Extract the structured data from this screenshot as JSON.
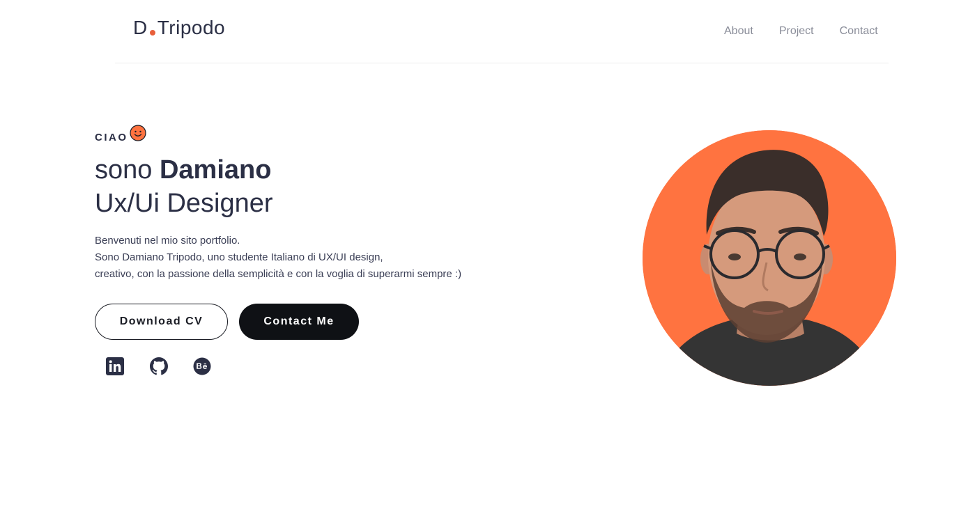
{
  "nav": {
    "logo_left": "D",
    "logo_right": "Tripodo",
    "links": [
      "About",
      "Project",
      "Contact"
    ]
  },
  "hero": {
    "greeting": "CIAO",
    "headline_prefix": "sono ",
    "headline_name": "Damiano",
    "subtitle": "Ux/Ui Designer",
    "intro": [
      "Benvenuti nel mio sito portfolio.",
      "Sono Damiano Tripodo, uno studente Italiano di UX/UI design,",
      "creativo, con la passione della semplicità e con la voglia di superarmi sempre :)"
    ],
    "download_label": "Download CV",
    "contact_label": "Contact Me"
  },
  "socials": [
    "linkedin-icon",
    "github-icon",
    "behance-icon"
  ],
  "colors": {
    "accent": "#ff7340",
    "text": "#2b2f45",
    "button_dark": "#0f1115",
    "nav_text": "#8a8d99"
  }
}
